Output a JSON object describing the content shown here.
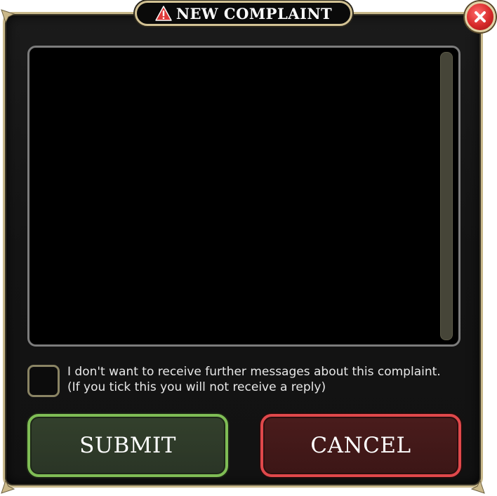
{
  "dialog": {
    "title": "NEW COMPLAINT",
    "title_icon": "warning-triangle-icon",
    "close_icon": "close-icon"
  },
  "message": {
    "value": ""
  },
  "opt_out": {
    "checked": false,
    "label_line1": "I don't want to receive further messages about this complaint.",
    "label_line2": "(If you tick this you will not receive a reply)"
  },
  "actions": {
    "submit_label": "SUBMIT",
    "cancel_label": "CANCEL"
  },
  "colors": {
    "frame_border": "#c9b98c",
    "submit_border": "#7fbd55",
    "cancel_border": "#e0484b",
    "close_red": "#d62a2a",
    "warning_red": "#e03b3b"
  }
}
